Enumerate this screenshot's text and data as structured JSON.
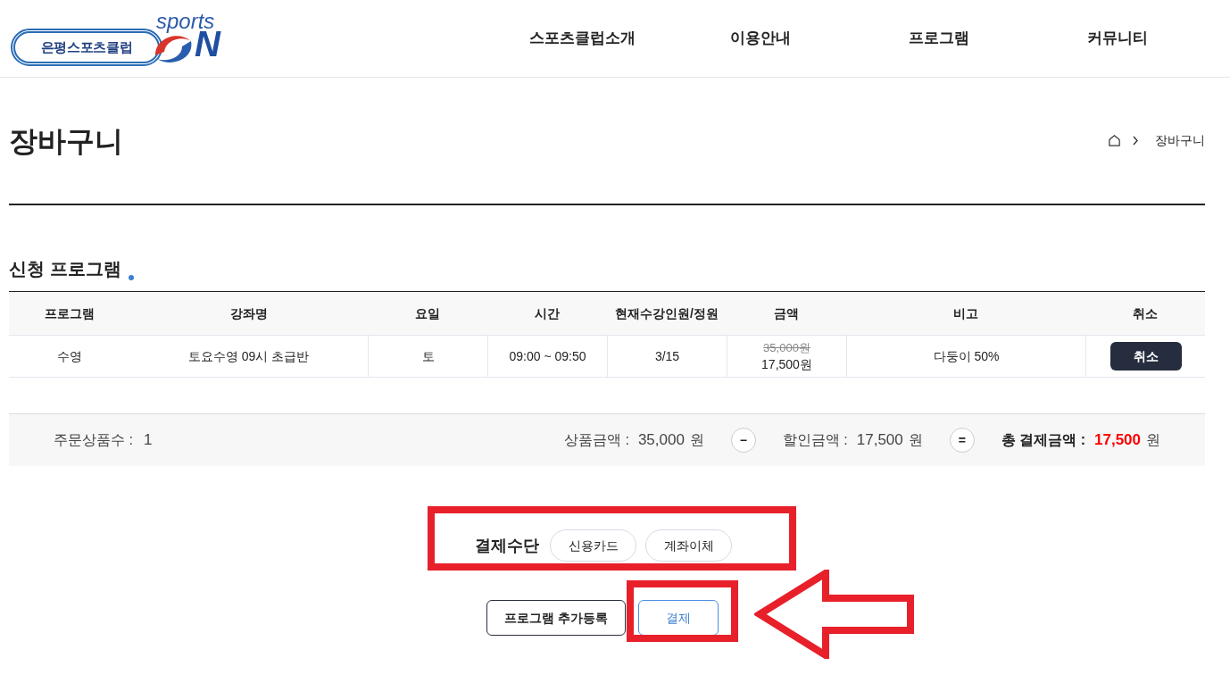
{
  "logo": {
    "badge": "은평스포츠클럽",
    "word": "sports",
    "letter": "N"
  },
  "nav": [
    "스포츠클럽소개",
    "이용안내",
    "프로그램",
    "커뮤니티"
  ],
  "page_title": "장바구니",
  "breadcrumb": [
    "장바구니"
  ],
  "section_title": "신청 프로그램",
  "table": {
    "columns": [
      "프로그램",
      "강좌명",
      "요일",
      "시간",
      "현재수강인원/정원",
      "금액",
      "비고",
      "취소"
    ],
    "rows": [
      {
        "program": "수영",
        "course": "토요수영 09시 초급반",
        "day": "토",
        "time": "09:00 ~ 09:50",
        "enrollment": "3/15",
        "original_price": "35,000원",
        "price": "17,500원",
        "note": "다둥이 50%",
        "cancel": "취소"
      }
    ]
  },
  "summary": {
    "count_label": "주문상품수 :",
    "count": "1",
    "goods_label": "상품금액 :",
    "goods": "35,000",
    "goods_unit": "원",
    "minus": "−",
    "discount_label": "할인금액 :",
    "discount": "17,500",
    "discount_unit": "원",
    "equals": "=",
    "total_label": "총 결제금액 :",
    "total": "17,500",
    "total_unit": "원"
  },
  "payment": {
    "label": "결제수단",
    "methods": [
      {
        "label": "신용카드",
        "selected": false
      },
      {
        "label": "계좌이체",
        "selected": false
      }
    ]
  },
  "buttons": [
    {
      "label": "프로그램 추가등록",
      "kind": "secondary"
    },
    {
      "label": "결제",
      "kind": "primary"
    }
  ]
}
